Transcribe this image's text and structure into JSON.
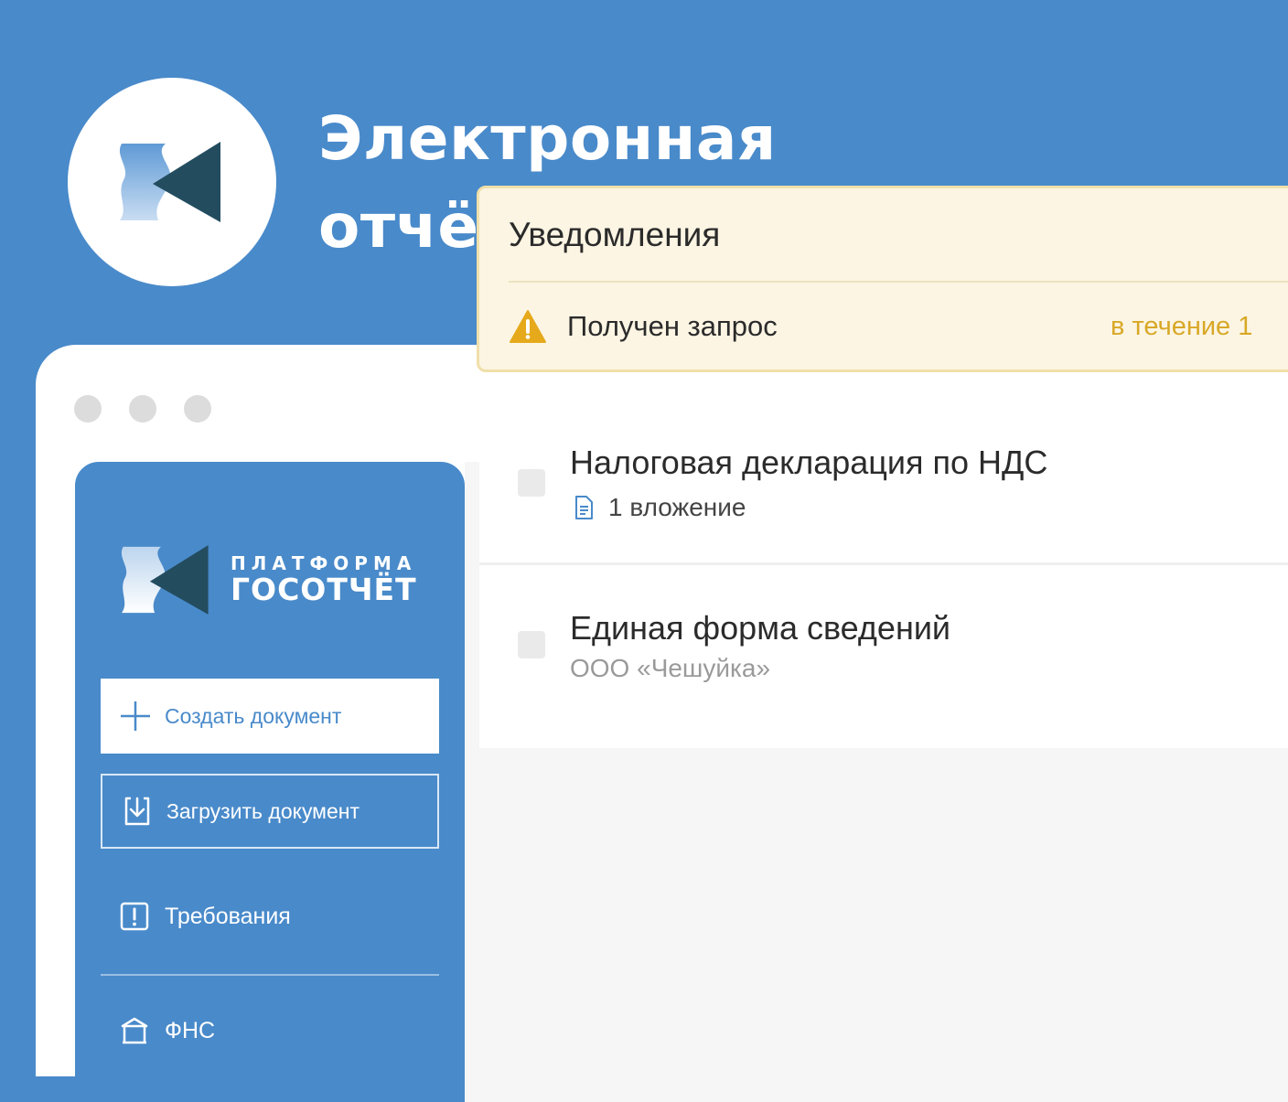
{
  "hero": {
    "title_line1": "Электронная",
    "title_line2": "отчётность в госорганы",
    "logo_icon": "gosotchet-logo-icon"
  },
  "sidebar": {
    "brand": {
      "line1": "ПЛАТФОРМА",
      "line2": "ГОСОТЧЁТ",
      "icon": "gosotchet-logo-icon"
    },
    "create_button": {
      "label": "Создать документ",
      "icon": "plus-icon"
    },
    "upload_button": {
      "label": "Загрузить документ",
      "icon": "upload-icon"
    },
    "nav": [
      {
        "label": "Требования",
        "icon": "alert-square-icon"
      },
      {
        "label": "ФНС",
        "icon": "building-icon"
      }
    ]
  },
  "notifications": {
    "title": "Уведомления",
    "items": [
      {
        "text": "Получен запрос",
        "deadline": "в течение 1",
        "icon": "warning-icon"
      }
    ]
  },
  "documents": [
    {
      "title": "Налоговая декларация по НДС",
      "subtitle": "1 вложение",
      "icon": "document-icon"
    },
    {
      "title": "Единая форма сведений",
      "subtitle": "ООО «Чешуйка»"
    }
  ],
  "colors": {
    "background": "#498aca",
    "logo_dark": "#234c5f",
    "notification_bg": "#fcf5e3",
    "deadline": "#d8a827",
    "warning": "#e5a91b"
  }
}
